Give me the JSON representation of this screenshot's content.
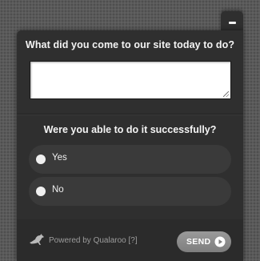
{
  "survey": {
    "question1": "What did you come to our site today to do?",
    "answer_value": "",
    "question2": "Were you able to do it successfully?",
    "options": [
      {
        "label": "Yes"
      },
      {
        "label": "No"
      }
    ]
  },
  "footer": {
    "powered_by": "Powered by Qualaroo [?]",
    "send_label": "SEND"
  },
  "icons": {
    "minimize": "minimize-icon",
    "brand": "kangaroo-icon",
    "send": "play-arrow-icon"
  }
}
